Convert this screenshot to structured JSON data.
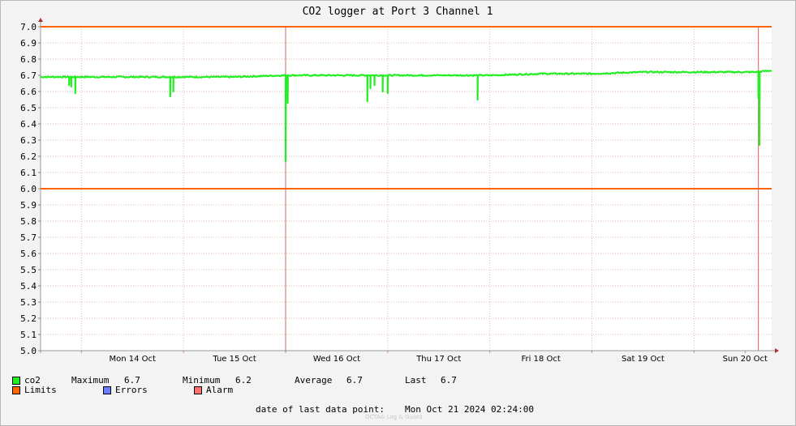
{
  "chart_data": {
    "type": "line",
    "title": "CO2 logger at Port 3 Channel 1",
    "ylim": [
      5.0,
      7.0
    ],
    "y_ticks": [
      "5.0",
      "5.1",
      "5.2",
      "5.3",
      "5.4",
      "5.5",
      "5.6",
      "5.7",
      "5.8",
      "5.9",
      "6.0",
      "6.1",
      "6.2",
      "6.3",
      "6.4",
      "6.5",
      "6.6",
      "6.7",
      "6.8",
      "6.9",
      "7.0"
    ],
    "x_tick_labels": [
      "Mon 14 Oct",
      "Tue 15 Oct",
      "Wed 16 Oct",
      "Thu 17 Oct",
      "Fri 18 Oct",
      "Sat 19 Oct",
      "Sun 20 Oct"
    ],
    "xlim_days": [
      13.6,
      20.76
    ],
    "grid": true,
    "limits": [
      6.0,
      7.0
    ],
    "alarm_day_markers": [
      16.0,
      20.63
    ],
    "series": [
      {
        "name": "co2",
        "color": "#22ee22",
        "baseline": [
          [
            13.6,
            6.69
          ],
          [
            14.5,
            6.69
          ],
          [
            15.0,
            6.69
          ],
          [
            15.5,
            6.69
          ],
          [
            16.0,
            6.7
          ],
          [
            16.5,
            6.7
          ],
          [
            17.0,
            6.7
          ],
          [
            17.5,
            6.7
          ],
          [
            18.0,
            6.7
          ],
          [
            18.5,
            6.71
          ],
          [
            19.0,
            6.71
          ],
          [
            19.5,
            6.72
          ],
          [
            20.0,
            6.72
          ],
          [
            20.3,
            6.72
          ],
          [
            20.6,
            6.72
          ],
          [
            20.76,
            6.73
          ]
        ],
        "dips": [
          [
            13.88,
            6.64
          ],
          [
            13.9,
            6.63
          ],
          [
            13.94,
            6.59
          ],
          [
            14.87,
            6.57
          ],
          [
            14.9,
            6.6
          ],
          [
            16.0,
            6.17
          ],
          [
            16.02,
            6.53
          ],
          [
            16.8,
            6.54
          ],
          [
            16.83,
            6.62
          ],
          [
            16.87,
            6.64
          ],
          [
            16.95,
            6.6
          ],
          [
            17.0,
            6.59
          ],
          [
            17.88,
            6.55
          ],
          [
            20.63,
            6.56
          ],
          [
            20.64,
            6.27
          ]
        ]
      },
      {
        "name": "Limits",
        "color": "#ff6600"
      },
      {
        "name": "Errors",
        "color": "#6a7dff"
      },
      {
        "name": "Alarm",
        "color": "#ff7070"
      }
    ]
  },
  "legend": {
    "co2_label": "co2",
    "maximum_label": "Maximum",
    "maximum_value": "6.7",
    "minimum_label": "Minimum",
    "minimum_value": "6.2",
    "average_label": "Average",
    "average_value": "6.7",
    "last_label": "Last",
    "last_value": "6.7",
    "limits_label": "Limits",
    "errors_label": "Errors",
    "alarm_label": "Alarm"
  },
  "footer": {
    "last_point_label": "date of last data point:",
    "last_point_value": "Mon Oct 21 2024 02:24:00",
    "watermark": "OCTA& Log & Guard"
  }
}
